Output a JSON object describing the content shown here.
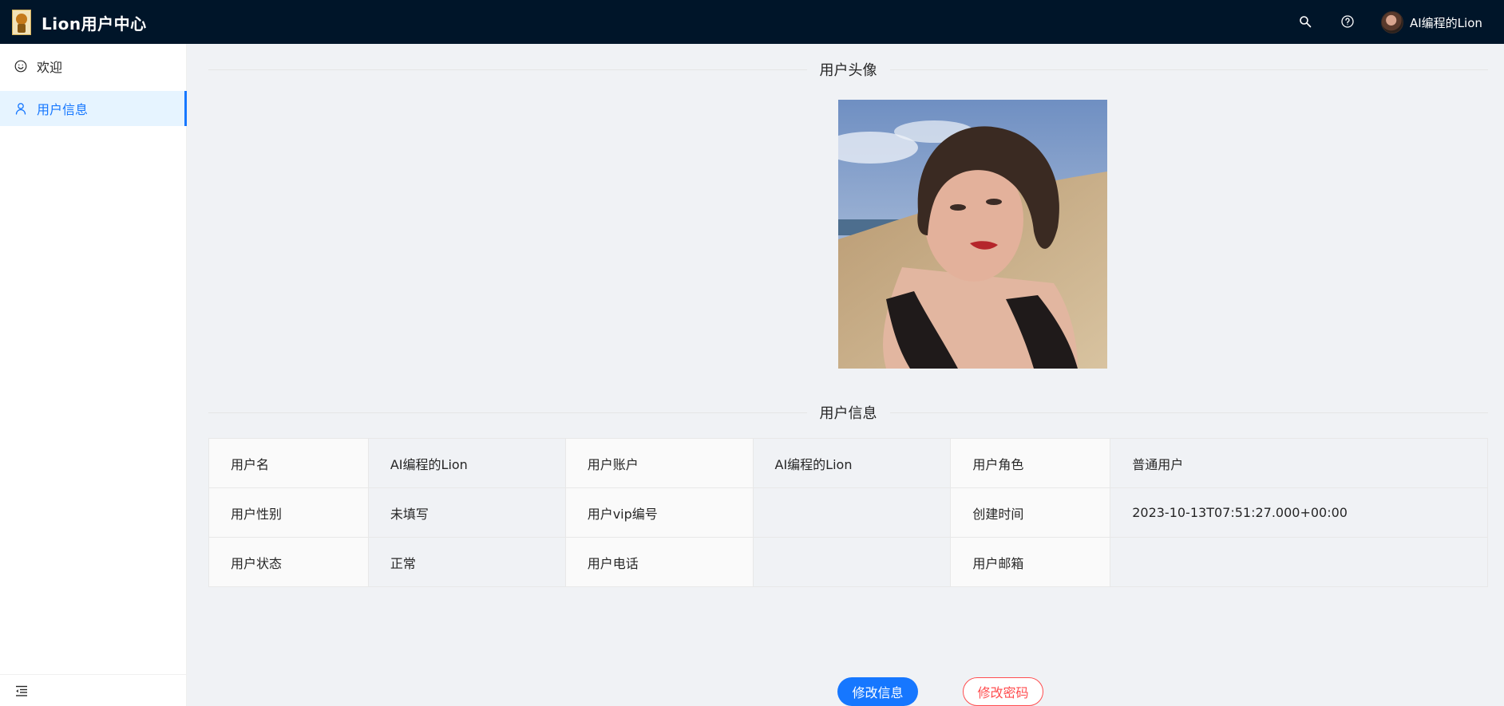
{
  "header": {
    "app_title": "Lion用户中心",
    "user_name": "AI编程的Lion",
    "icons": [
      "search-icon",
      "question-circle-icon"
    ]
  },
  "sidebar": {
    "items": [
      {
        "label": "欢迎",
        "icon": "smile-icon",
        "active": false
      },
      {
        "label": "用户信息",
        "icon": "user-icon",
        "active": true
      }
    ],
    "collapse_icon": "menu-fold-icon"
  },
  "sections": {
    "avatar_title": "用户头像",
    "info_title": "用户信息"
  },
  "user_info": {
    "rows": [
      [
        {
          "label": "用户名",
          "value": "AI编程的Lion"
        },
        {
          "label": "用户账户",
          "value": "AI编程的Lion"
        },
        {
          "label": "用户角色",
          "value": "普通用户"
        }
      ],
      [
        {
          "label": "用户性别",
          "value": "未填写"
        },
        {
          "label": "用户vip编号",
          "value": ""
        },
        {
          "label": "创建时间",
          "value": "2023-10-13T07:51:27.000+00:00"
        }
      ],
      [
        {
          "label": "用户状态",
          "value": "正常"
        },
        {
          "label": "用户电话",
          "value": ""
        },
        {
          "label": "用户邮箱",
          "value": ""
        }
      ]
    ]
  },
  "actions": {
    "edit_info": "修改信息",
    "change_password": "修改密码"
  },
  "colors": {
    "header_bg": "#001529",
    "primary": "#1677ff",
    "danger": "#ff4d4f"
  }
}
